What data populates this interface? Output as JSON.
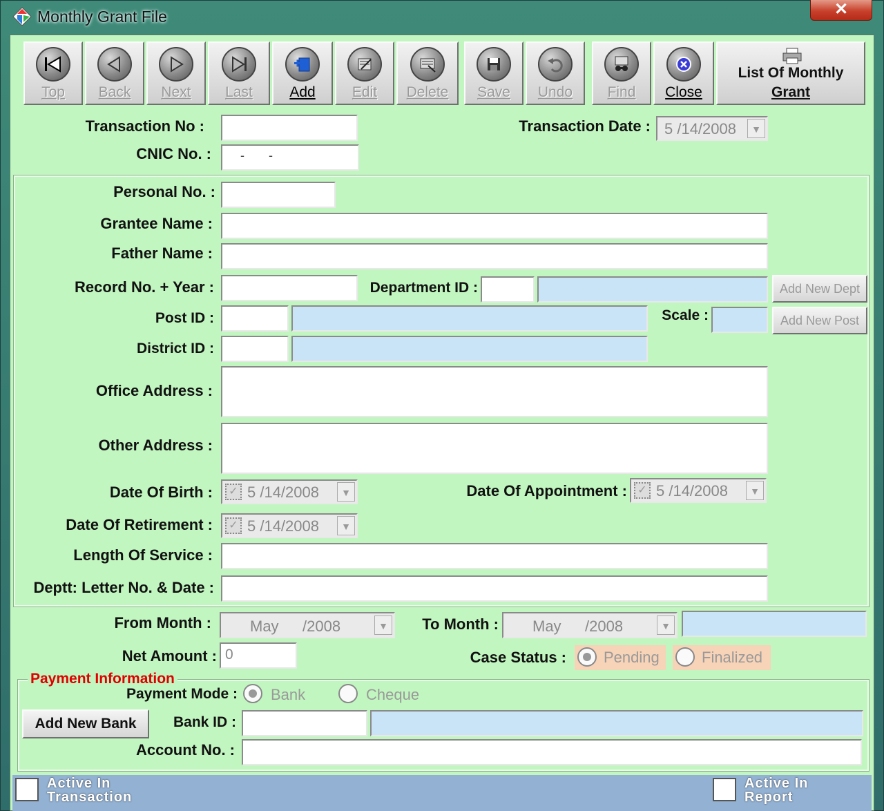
{
  "window": {
    "title": "Monthly Grant File",
    "close_glyph": "✕"
  },
  "toolbar": {
    "top": "Top",
    "back": "Back",
    "next": "Next",
    "last": "Last",
    "add": "Add",
    "edit": "Edit",
    "delete": "Delete",
    "save": "Save",
    "undo": "Undo",
    "find": "Find",
    "close": "Close",
    "list_line1": "List Of Monthly",
    "list_line2": "Grant"
  },
  "header": {
    "transaction_no_label": "Transaction No :",
    "transaction_no_value": "",
    "transaction_date_label": "Transaction Date :",
    "transaction_date_value": "5 /14/2008",
    "cnic_label": "CNIC No. :",
    "cnic_value": "    -       -"
  },
  "personal": {
    "personal_no_label": "Personal No. :",
    "grantee_name_label": "Grantee Name :",
    "father_name_label": "Father Name :",
    "record_no_label": "Record No. + Year :",
    "department_id_label": "Department ID :",
    "add_new_dept": "Add New Dept",
    "post_id_label": "Post ID :",
    "scale_label": "Scale :",
    "add_new_post": "Add New Post",
    "district_id_label": "District ID :",
    "office_address_label": "Office Address :",
    "other_address_label": "Other Address :",
    "dob_label": "Date Of Birth :",
    "dob_value": "5 /14/2008",
    "doa_label": "Date Of Appointment :",
    "doa_value": "5 /14/2008",
    "dor_label": "Date Of Retirement :",
    "dor_value": "5 /14/2008",
    "length_of_service_label": "Length Of Service :",
    "deptt_letter_label": "Deptt: Letter No. & Date :"
  },
  "period": {
    "from_month_label": "From Month :",
    "from_month_value": "May",
    "from_year_value": "/2008",
    "to_month_label": "To Month :",
    "to_month_value": "May",
    "to_year_value": "/2008",
    "net_amount_label": "Net Amount :",
    "net_amount_value": "0",
    "case_status_label": "Case Status :",
    "status_pending": "Pending",
    "status_finalized": "Finalized"
  },
  "payment": {
    "group_title": "Payment Information",
    "mode_label": "Payment Mode :",
    "mode_bank": "Bank",
    "mode_cheque": "Cheque",
    "add_new_bank": "Add New Bank",
    "bank_id_label": "Bank ID :",
    "account_no_label": "Account No. :"
  },
  "statusbar": {
    "left_line1": "Active In",
    "left_line2": "Transaction",
    "right_line1": "Active In",
    "right_line2": "Report"
  },
  "colors": {
    "form_bg": "#c2f6c0",
    "readonly_bg": "#c9e3f7",
    "group_title": "#e00000"
  },
  "icons": [
    "first-record-icon",
    "previous-record-icon",
    "next-record-icon",
    "last-record-icon",
    "add-record-icon",
    "edit-record-icon",
    "delete-record-icon",
    "save-icon",
    "undo-icon",
    "find-icon",
    "close-icon",
    "printer-icon",
    "app-icon"
  ]
}
